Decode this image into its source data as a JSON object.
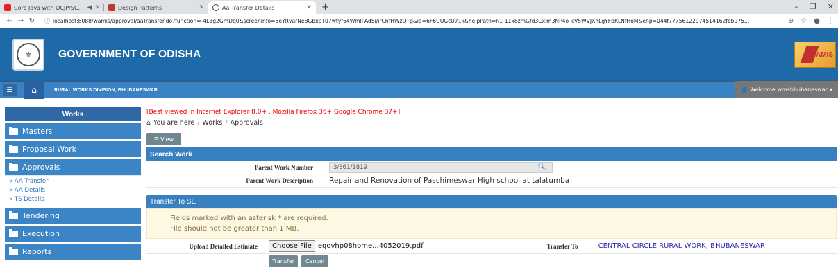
{
  "browser": {
    "tabs": [
      {
        "title": "Core Java with OCJP/SCJP: L",
        "favicon_color": "#e62117"
      },
      {
        "title": "Design Patterns",
        "favicon_color": "#c0392b"
      },
      {
        "title": "Aa Transfer Details",
        "favicon_color": "#3c4043"
      }
    ],
    "new_tab": "+",
    "window_controls": [
      "–",
      "❐",
      "✕"
    ],
    "url": "localhost:8088/wamis/approval/aaTransfer.do?function=-4L3g2GmDq0&screenInfo=5eYRvarNe8GbxpT07wtyf64WmlPAd5i/irChfHWzQTg&id=6F6UUGcU71k&helpPath=n1-11x8zmGfd3Cxim3NP4o_cV5WVJXhLgYFbKLNfHoM&enp=044f77756122974514162feb975..."
  },
  "header": {
    "title": "GOVERNMENT OF ODISHA",
    "logo_text": "WAMIS"
  },
  "navbar": {
    "division": "RURAL WORKS DIVISION, BHUBANESWAR",
    "welcome": "Welcome wmsbhubaneswar"
  },
  "sidebar": {
    "heading": "Works",
    "items": [
      {
        "label": "Masters"
      },
      {
        "label": "Proposal Work"
      },
      {
        "label": "Approvals"
      },
      {
        "label": "Tendering"
      },
      {
        "label": "Execution"
      },
      {
        "label": "Reports"
      }
    ],
    "subitems": [
      "» AA Transfer",
      "» AA Details",
      "» TS Details"
    ]
  },
  "main": {
    "notice": "[Best viewed in Internet Explorer 8.0+ , Mozilla Firefox 36+,Google Chrome 37+]",
    "breadcrumb": [
      "You are here",
      "Works",
      "Approvals"
    ],
    "view_button": "View",
    "search_panel": {
      "heading": "Search Work",
      "parent_work_number_label": "Parent Work Number",
      "parent_work_number_value": "3/861/1819",
      "parent_work_description_label": "Parent Work Description",
      "parent_work_description_value": "Repair and Renovation of Paschimeswar High school at talatumba"
    },
    "transfer_panel": {
      "heading": "Transfer To SE",
      "alert_line1": "Fields marked with an asterisk * are required.",
      "alert_line2": "File should not be greater than 1 MB.",
      "upload_label": "Upload Detailed Estimate",
      "choose_file": "Choose File",
      "file_name": "egovhp08home...4052019.pdf",
      "transfer_to_label": "Transfer To",
      "transfer_to_value": "CENTRAL CIRCLE RURAL WORK, BHUBANESWAR",
      "transfer_button": "Transfer",
      "cancel_button": "Cancel"
    }
  }
}
